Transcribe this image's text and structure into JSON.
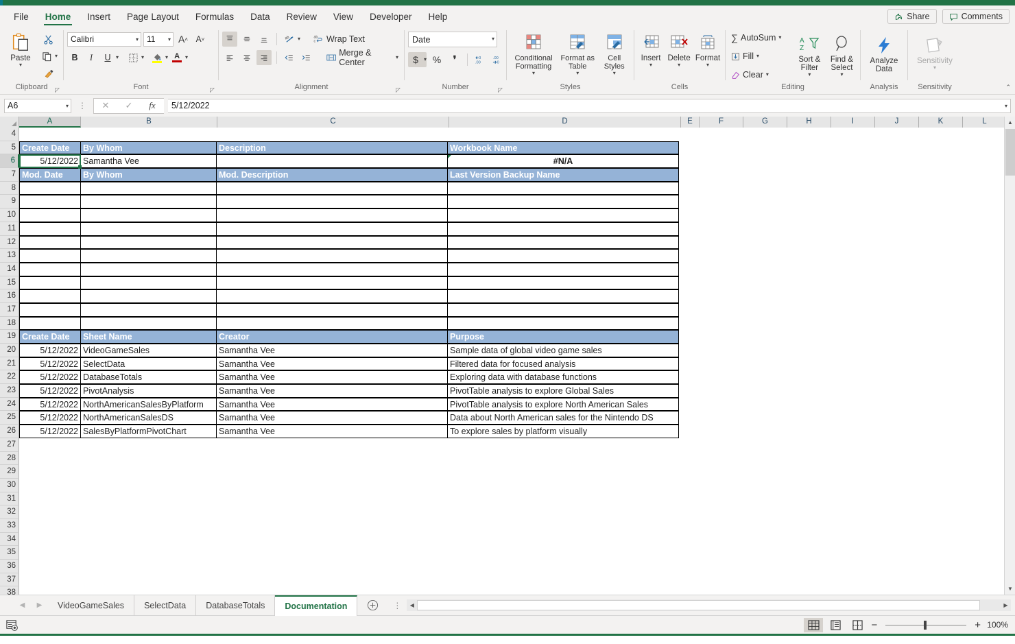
{
  "app": {
    "accent": "#217346",
    "header_blue": "#95b3d7"
  },
  "ribbon": {
    "tabs": [
      {
        "label": "File"
      },
      {
        "label": "Home"
      },
      {
        "label": "Insert"
      },
      {
        "label": "Page Layout"
      },
      {
        "label": "Formulas"
      },
      {
        "label": "Data"
      },
      {
        "label": "Review"
      },
      {
        "label": "View"
      },
      {
        "label": "Developer"
      },
      {
        "label": "Help"
      }
    ],
    "active_tab": "Home",
    "share_label": "Share",
    "comments_label": "Comments",
    "groups": {
      "clipboard": {
        "label": "Clipboard",
        "paste": "Paste"
      },
      "font": {
        "label": "Font",
        "font_name": "Calibri",
        "font_size": "11",
        "grow": "A",
        "shrink": "A",
        "bold": "B",
        "italic": "I",
        "underline": "U"
      },
      "alignment": {
        "label": "Alignment",
        "wrap_text": "Wrap Text",
        "merge_center": "Merge & Center"
      },
      "number": {
        "label": "Number",
        "format": "Date",
        "currency": "$",
        "percent": "%",
        "comma": ","
      },
      "styles": {
        "label": "Styles",
        "conditional_formatting": "Conditional Formatting",
        "format_as_table": "Format as Table",
        "cell_styles": "Cell Styles"
      },
      "cells": {
        "label": "Cells",
        "insert": "Insert",
        "delete": "Delete",
        "format": "Format"
      },
      "editing": {
        "label": "Editing",
        "autosum": "AutoSum",
        "fill": "Fill",
        "clear": "Clear",
        "sort_filter": "Sort & Filter",
        "find_select": "Find & Select"
      },
      "analysis": {
        "label": "Analysis",
        "analyze_data": "Analyze Data"
      },
      "sensitivity": {
        "label": "Sensitivity",
        "sensitivity": "Sensitivity"
      }
    }
  },
  "formula_bar": {
    "name_box": "A6",
    "value": "5/12/2022"
  },
  "grid": {
    "columns": [
      "A",
      "B",
      "C",
      "D",
      "E",
      "F",
      "G",
      "H",
      "I",
      "J",
      "K",
      "L"
    ],
    "selected_column": "A",
    "selected_row": "6",
    "rows": [
      "4",
      "5",
      "6",
      "7",
      "8",
      "9",
      "10",
      "11",
      "12",
      "13",
      "14",
      "15",
      "16",
      "17",
      "18",
      "19",
      "20",
      "21",
      "22",
      "23",
      "24",
      "25",
      "26",
      "27",
      "28",
      "29",
      "30",
      "31",
      "32",
      "33",
      "34",
      "35",
      "36",
      "37",
      "38"
    ],
    "table1": {
      "header1": [
        "Create Date",
        "By Whom",
        "Description",
        "Workbook Name"
      ],
      "row1": [
        "5/12/2022",
        "Samantha Vee",
        "",
        "#N/A"
      ],
      "header2": [
        "Mod. Date",
        "By Whom",
        "Mod. Description",
        "Last Version Backup Name"
      ],
      "blank_rows": 11
    },
    "table2": {
      "headers": [
        "Create Date",
        "Sheet Name",
        "Creator",
        "Purpose"
      ],
      "rows": [
        [
          "5/12/2022",
          "VideoGameSales",
          "Samantha Vee",
          "Sample data of global video game sales"
        ],
        [
          "5/12/2022",
          "SelectData",
          "Samantha Vee",
          "Filtered data for focused analysis"
        ],
        [
          "5/12/2022",
          "DatabaseTotals",
          "Samantha Vee",
          "Exploring data with database functions"
        ],
        [
          "5/12/2022",
          "PivotAnalysis",
          "Samantha Vee",
          "PivotTable analysis to explore Global Sales"
        ],
        [
          "5/12/2022",
          "NorthAmericanSalesByPlatform",
          "Samantha Vee",
          "PivotTable analysis to explore North American Sales"
        ],
        [
          "5/12/2022",
          "NorthAmericanSalesDS",
          "Samantha Vee",
          "Data about North American sales for the Nintendo DS"
        ],
        [
          "5/12/2022",
          "SalesByPlatformPivotChart",
          "Samantha Vee",
          "To explore sales by platform visually"
        ]
      ]
    }
  },
  "sheet_tabs": {
    "tabs": [
      "VideoGameSales",
      "SelectData",
      "DatabaseTotals",
      "Documentation"
    ],
    "active": "Documentation",
    "add_label": "+"
  },
  "status_bar": {
    "zoom": "100%",
    "zoom_minus": "−",
    "zoom_plus": "+"
  }
}
